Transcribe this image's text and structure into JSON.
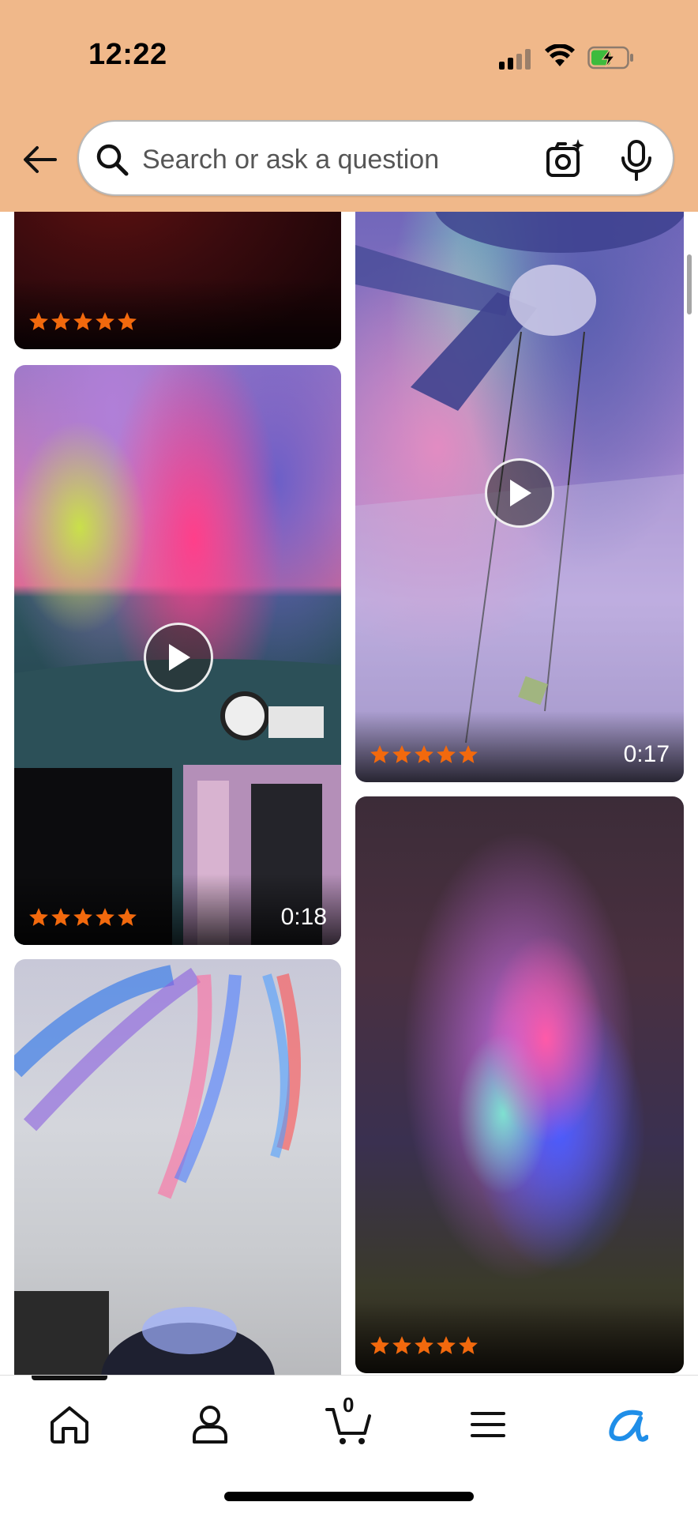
{
  "status_bar": {
    "time": "12:22"
  },
  "search": {
    "placeholder": "Search or ask a question"
  },
  "cards": [
    {
      "id": "card-1",
      "stars": 5,
      "duration": ""
    },
    {
      "id": "card-2",
      "stars": 5,
      "duration": "0:17"
    },
    {
      "id": "card-3",
      "stars": 5,
      "duration": "0:18"
    },
    {
      "id": "card-4",
      "stars": 5,
      "duration": ""
    },
    {
      "id": "card-5",
      "stars": 0,
      "duration": ""
    }
  ],
  "labels": {
    "card2_duration": "0:17",
    "card3_duration": "0:18"
  },
  "nav": {
    "cart_count": "0",
    "items": [
      "home-icon",
      "account-icon",
      "cart-icon",
      "menu-icon",
      "rufus-icon"
    ]
  },
  "colors": {
    "header": "#f0b88a",
    "star": "#f2690d",
    "accent_blue": "#1f8ee8"
  }
}
